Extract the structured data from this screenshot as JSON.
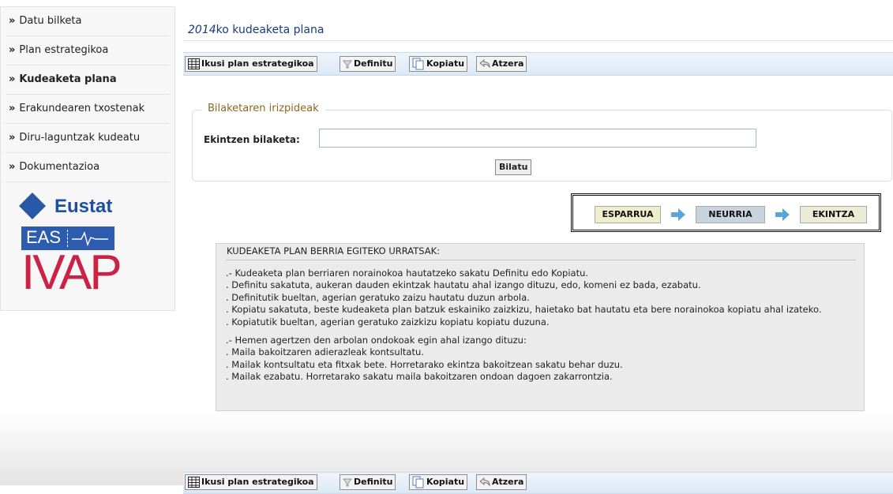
{
  "sidebar": {
    "bullet": "»",
    "items": [
      {
        "label": "Datu bilketa",
        "active": false
      },
      {
        "label": "Plan estrategikoa",
        "active": false
      },
      {
        "label": "Kudeaketa plana",
        "active": true
      },
      {
        "label": "Erakundearen txostenak",
        "active": false
      },
      {
        "label": "Diru-laguntzak kudeatu",
        "active": false
      },
      {
        "label": "Dokumentazioa",
        "active": false
      }
    ],
    "logos": {
      "eustat": "Eustat",
      "eas": "EAS",
      "ivap": "IVAP"
    }
  },
  "page": {
    "title_year": "2014",
    "title_rest": "ko kudeaketa plana"
  },
  "toolbar": {
    "buttons": [
      {
        "label": "Ikusi plan estrategikoa",
        "icon": "table-icon"
      },
      {
        "label": "Definitu",
        "icon": "filter-icon"
      },
      {
        "label": "Kopiatu",
        "icon": "copy-icon"
      },
      {
        "label": "Atzera",
        "icon": "back-arrow-icon"
      }
    ]
  },
  "search": {
    "legend": "Bilaketaren irizpideak",
    "label": "Ekintzen bilaketa:",
    "value": "",
    "placeholder": "",
    "button": "Bilatu"
  },
  "flow": {
    "steps": [
      {
        "label": "ESPARRUA",
        "color": "#eeeecc"
      },
      {
        "label": "NEURRIA",
        "color": "#c9d3de"
      },
      {
        "label": "EKINTZA",
        "color": "#ecebd5"
      }
    ],
    "arrow_color": "#58a6dd"
  },
  "instructions": {
    "title": "KUDEAKETA PLAN BERRIA EGITEKO URRATSAK:",
    "block1": [
      ".- Kudeaketa plan berriaren norainokoa hautatzeko sakatu Definitu edo Kopiatu.",
      "  . Definitu sakatuta, aukeran dauden ekintzak hautatu ahal izango dituzu, edo, komeni ez bada, ezabatu.",
      "  . Definitutik bueltan, agerian geratuko zaizu hautatu duzun arbola.",
      "  . Kopiatu sakatuta, beste kudeaketa plan batzuk eskainiko zaizkizu, haietako bat hautatu eta bere norainokoa kopiatu ahal izateko.",
      "  . Kopiatutik bueltan, agerian geratuko zaizkizu kopiatu kopiatu duzuna."
    ],
    "block2": [
      ".- Hemen agertzen den arbolan ondokoak egin ahal izango dituzu:",
      "  . Maila bakoitzaren adierazleak kontsultatu.",
      "  . Mailak kontsultatu eta fitxak bete. Horretarako ekintza bakoitzean sakatu behar duzu.",
      "  . Mailak ezabatu. Horretarako sakatu maila bakoitzaren ondoan dagoen zakarrontzia."
    ]
  }
}
